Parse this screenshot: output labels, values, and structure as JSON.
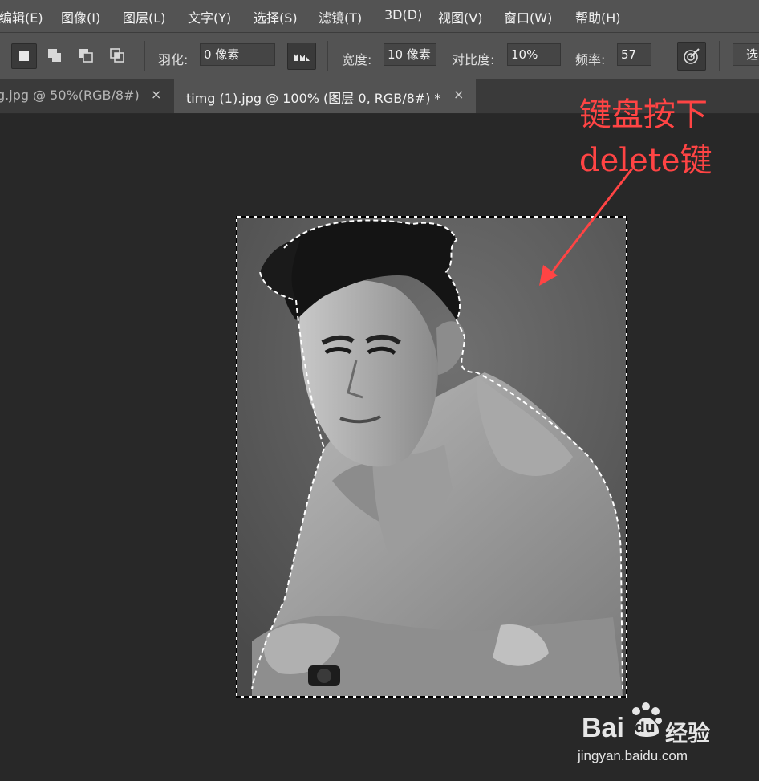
{
  "menu": [
    "编辑(E)",
    "图像(I)",
    "图层(L)",
    "文字(Y)",
    "选择(S)",
    "滤镜(T)",
    "3D(D)",
    "视图(V)",
    "窗口(W)",
    "帮助(H)"
  ],
  "options": {
    "feather_label": "羽化:",
    "feather_value": "0 像素",
    "width_label": "宽度:",
    "width_value": "10 像素",
    "contrast_label": "对比度:",
    "contrast_value": "10%",
    "frequency_label": "频率:",
    "frequency_value": "57",
    "select_button": "选"
  },
  "tabs": [
    {
      "label": "g.jpg @ 50%(RGB/8#)",
      "close": "×",
      "active": false
    },
    {
      "label": "timg (1).jpg @ 100% (图层 0, RGB/8#) *",
      "close": "×",
      "active": true
    }
  ],
  "annotation": {
    "line1": "键盘按下",
    "line2": "delete键",
    "color": "#ff4444"
  },
  "watermark": {
    "brand": "Bai",
    "brand2": "du",
    "brand_cn": "经验",
    "url": "jingyan.baidu.com"
  },
  "colors": {
    "menubar": "#535353",
    "canvas": "#282828",
    "tab_active": "#535353",
    "tab_inactive": "#3a3a3a"
  }
}
